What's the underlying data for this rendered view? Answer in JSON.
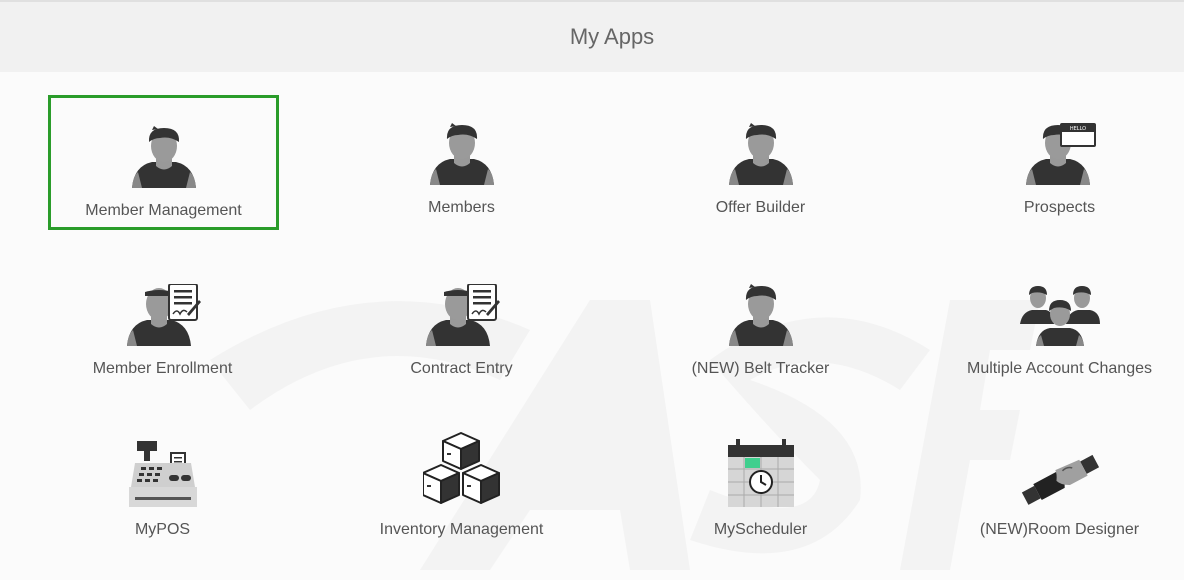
{
  "header": {
    "title": "My Apps"
  },
  "apps": [
    {
      "label": "Member Management",
      "icon": "person-icon",
      "selected": true
    },
    {
      "label": "Members",
      "icon": "person-icon"
    },
    {
      "label": "Offer Builder",
      "icon": "person-icon"
    },
    {
      "label": "Prospects",
      "icon": "person-hello-tag-icon"
    },
    {
      "label": "Member Enrollment",
      "icon": "person-document-icon"
    },
    {
      "label": "Contract Entry",
      "icon": "person-document-icon"
    },
    {
      "label": "(NEW) Belt Tracker",
      "icon": "person-icon"
    },
    {
      "label": "Multiple Account Changes",
      "icon": "group-icon"
    },
    {
      "label": "MyPOS",
      "icon": "cash-register-icon"
    },
    {
      "label": "Inventory Management",
      "icon": "boxes-icon"
    },
    {
      "label": "MyScheduler",
      "icon": "calendar-clock-icon"
    },
    {
      "label": "(NEW)Room Designer",
      "icon": "handshake-icon"
    }
  ],
  "icon_tag_text": "HELLO",
  "colors": {
    "selected_border": "#2a9c2a",
    "accent_green": "#3fcf8e"
  }
}
